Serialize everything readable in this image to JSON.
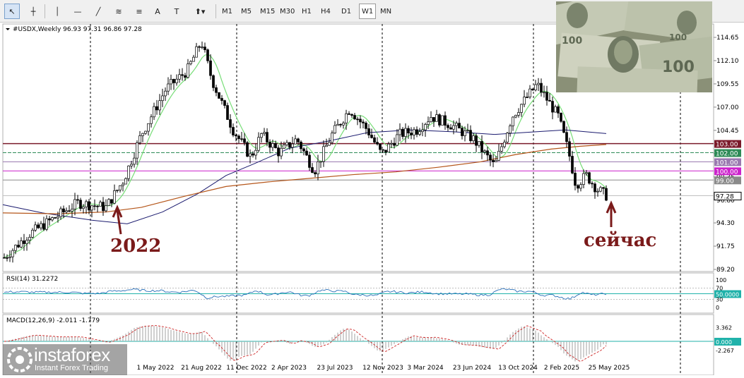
{
  "toolbar": {
    "tools": [
      {
        "name": "cursor-tool",
        "glyph": "↖"
      },
      {
        "name": "crosshair-tool",
        "glyph": "┼"
      },
      {
        "name": "vertical-line-tool",
        "glyph": "│"
      },
      {
        "name": "horizontal-line-tool",
        "glyph": "—"
      },
      {
        "name": "trendline-tool",
        "glyph": "╱"
      },
      {
        "name": "equidistant-channel-tool",
        "glyph": "≋"
      },
      {
        "name": "fibonacci-tool",
        "glyph": "≡"
      },
      {
        "name": "text-tool",
        "glyph": "A"
      },
      {
        "name": "text-label-tool",
        "glyph": "T"
      },
      {
        "name": "shapes-dropdown-tool",
        "glyph": "⬆▾"
      }
    ],
    "timeframes": [
      "M1",
      "M5",
      "M15",
      "M30",
      "H1",
      "H4",
      "D1",
      "W1",
      "MN"
    ],
    "active_timeframe": "W1"
  },
  "chart": {
    "symbol_info": "#USDX,Weekly  96.93 97.31 96.86 97.28",
    "price_labels": [
      "114.65",
      "112.10",
      "109.55",
      "107.00",
      "104.45",
      "101.90",
      "99.35",
      "96.80",
      "94.30",
      "91.75",
      "89.20"
    ],
    "levels": [
      {
        "label": "103.00",
        "color": "#7a1a2a",
        "value": 103.0
      },
      {
        "label": "102.00",
        "color": "#2e8b57",
        "value": 102.0
      },
      {
        "label": "101.00",
        "color": "#9a7ab0",
        "value": 101.0
      },
      {
        "label": "100.00",
        "color": "#cc22cc",
        "value": 100.0
      },
      {
        "label": "99.00",
        "color": "#8a8a8a",
        "value": 99.0
      }
    ],
    "current_price": "97.28",
    "x_labels": [
      "1 May 2022",
      "21 Aug 2022",
      "11 Dec 2022",
      "2 Apr 2023",
      "23 Jul 2023",
      "12 Nov 2023",
      "3 Mar 2024",
      "23 Jun 2024",
      "13 Oct 2024",
      "2 Feb 2025",
      "25 May 2025"
    ],
    "annotation_2022": "2022",
    "annotation_now": "сейчас"
  },
  "rsi": {
    "header": "RSI(14) 31.2272",
    "levels": [
      "100",
      "70",
      "50.0000",
      "30",
      "0"
    ]
  },
  "macd": {
    "header": "MACD(12,26,9) -2.011 -1.779",
    "levels": [
      "3.362",
      "0.000",
      "-2.267"
    ]
  },
  "logo": {
    "name": "instaforex",
    "tagline": "Instant Forex Trading"
  }
}
